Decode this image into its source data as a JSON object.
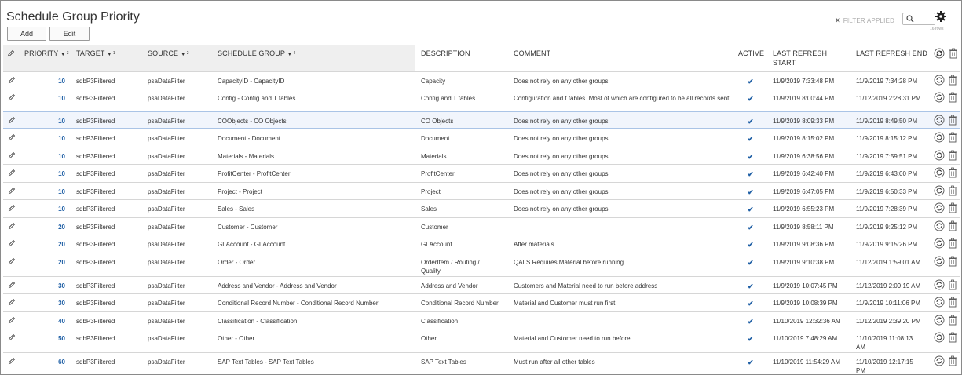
{
  "page": {
    "title": "Schedule Group Priority",
    "add_label": "Add",
    "edit_label": "Edit",
    "filter_label": "FILTER APPLIED",
    "rows_count": "16 rows"
  },
  "columns": {
    "priority": "PRIORITY",
    "priority_sort": "3",
    "target": "TARGET",
    "target_sort": "1",
    "source": "SOURCE",
    "source_sort": "2",
    "schedule_group": "SCHEDULE GROUP",
    "schedule_group_sort": "4",
    "description": "DESCRIPTION",
    "comment": "COMMENT",
    "active": "ACTIVE",
    "refresh_start_1": "LAST REFRESH",
    "refresh_start_2": "START",
    "refresh_end": "LAST REFRESH END"
  },
  "rows": [
    {
      "priority": "10",
      "target": "sdbP3Filtered",
      "source": "psaDataFilter",
      "group": "CapacityID -  CapacityID",
      "description": "Capacity",
      "comment": "Does not rely on any other groups",
      "active": "✔",
      "start": "11/9/2019 7:33:48 PM",
      "end": "11/9/2019 7:34:28 PM"
    },
    {
      "priority": "10",
      "target": "sdbP3Filtered",
      "source": "psaDataFilter",
      "group": "Config -  Config and T tables",
      "description": "Config and T tables",
      "comment": "Configuration and t tables. Most of which are configured to be all records sent",
      "active": "✔",
      "start": "11/9/2019 8:00:44 PM",
      "end": "11/12/2019 2:28:31 PM"
    },
    {
      "priority": "10",
      "target": "sdbP3Filtered",
      "source": "psaDataFilter",
      "group": "COObjects -  CO Objects",
      "description": "CO Objects",
      "comment": "Does not rely on any other groups",
      "active": "✔",
      "start": "11/9/2019 8:09:33 PM",
      "end": "11/9/2019 8:49:50 PM"
    },
    {
      "priority": "10",
      "target": "sdbP3Filtered",
      "source": "psaDataFilter",
      "group": "Document -  Document",
      "description": "Document",
      "comment": "Does not rely on any other groups",
      "active": "✔",
      "start": "11/9/2019 8:15:02 PM",
      "end": "11/9/2019 8:15:12 PM"
    },
    {
      "priority": "10",
      "target": "sdbP3Filtered",
      "source": "psaDataFilter",
      "group": "Materials -  Materials",
      "description": "Materials",
      "comment": "Does not rely on any other groups",
      "active": "✔",
      "start": "11/9/2019 6:38:56 PM",
      "end": "11/9/2019 7:59:51 PM"
    },
    {
      "priority": "10",
      "target": "sdbP3Filtered",
      "source": "psaDataFilter",
      "group": "ProfitCenter -  ProfitCenter",
      "description": "ProfitCenter",
      "comment": "Does not rely on any other groups",
      "active": "✔",
      "start": "11/9/2019 6:42:40 PM",
      "end": "11/9/2019 6:43:00 PM"
    },
    {
      "priority": "10",
      "target": "sdbP3Filtered",
      "source": "psaDataFilter",
      "group": "Project -  Project",
      "description": "Project",
      "comment": "Does not rely on any other groups",
      "active": "✔",
      "start": "11/9/2019 6:47:05 PM",
      "end": "11/9/2019 6:50:33 PM"
    },
    {
      "priority": "10",
      "target": "sdbP3Filtered",
      "source": "psaDataFilter",
      "group": "Sales -  Sales",
      "description": "Sales",
      "comment": "Does not rely on any other groups",
      "active": "✔",
      "start": "11/9/2019 6:55:23 PM",
      "end": "11/9/2019 7:28:39 PM"
    },
    {
      "priority": "20",
      "target": "sdbP3Filtered",
      "source": "psaDataFilter",
      "group": "Customer -  Customer",
      "description": "Customer",
      "comment": "",
      "active": "✔",
      "start": "11/9/2019 8:58:11 PM",
      "end": "11/9/2019 9:25:12 PM"
    },
    {
      "priority": "20",
      "target": "sdbP3Filtered",
      "source": "psaDataFilter",
      "group": "GLAccount -  GLAccount",
      "description": "GLAccount",
      "comment": "After materials",
      "active": "✔",
      "start": "11/9/2019 9:08:36 PM",
      "end": "11/9/2019 9:15:26 PM"
    },
    {
      "priority": "20",
      "target": "sdbP3Filtered",
      "source": "psaDataFilter",
      "group": "Order -  Order",
      "description": "OrderItem / Routing / Quality",
      "comment": "QALS Requires Material before running",
      "active": "✔",
      "start": "11/9/2019 9:10:38 PM",
      "end": "11/12/2019 1:59:01 AM"
    },
    {
      "priority": "30",
      "target": "sdbP3Filtered",
      "source": "psaDataFilter",
      "group": "Address and Vendor -  Address and Vendor",
      "description": "Address and Vendor",
      "comment": "Customers and Material need to run before address",
      "active": "✔",
      "start": "11/9/2019 10:07:45 PM",
      "end": "11/12/2019 2:09:19 AM"
    },
    {
      "priority": "30",
      "target": "sdbP3Filtered",
      "source": "psaDataFilter",
      "group": "Conditional Record Number -  Conditional Record Number",
      "description": "Conditional Record Number",
      "comment": "Material and Customer  must run first",
      "active": "✔",
      "start": "11/9/2019 10:08:39 PM",
      "end": "11/9/2019 10:11:06 PM"
    },
    {
      "priority": "40",
      "target": "sdbP3Filtered",
      "source": "psaDataFilter",
      "group": "Classification -  Classification",
      "description": "Classification",
      "comment": "",
      "active": "✔",
      "start": "11/10/2019 12:32:36 AM",
      "end": "11/12/2019 2:39:20 PM"
    },
    {
      "priority": "50",
      "target": "sdbP3Filtered",
      "source": "psaDataFilter",
      "group": "Other -  Other",
      "description": "Other",
      "comment": "Material and Customer need to run before",
      "active": "✔",
      "start": "11/10/2019 7:48:29 AM",
      "end": "11/10/2019 11:08:13 AM"
    },
    {
      "priority": "60",
      "target": "sdbP3Filtered",
      "source": "psaDataFilter",
      "group": "SAP Text Tables -  SAP Text Tables",
      "description": "SAP Text Tables",
      "comment": "Must run after all other tables",
      "active": "✔",
      "start": "11/10/2019 11:54:29 AM",
      "end": "11/10/2019 12:17:15 PM"
    }
  ]
}
